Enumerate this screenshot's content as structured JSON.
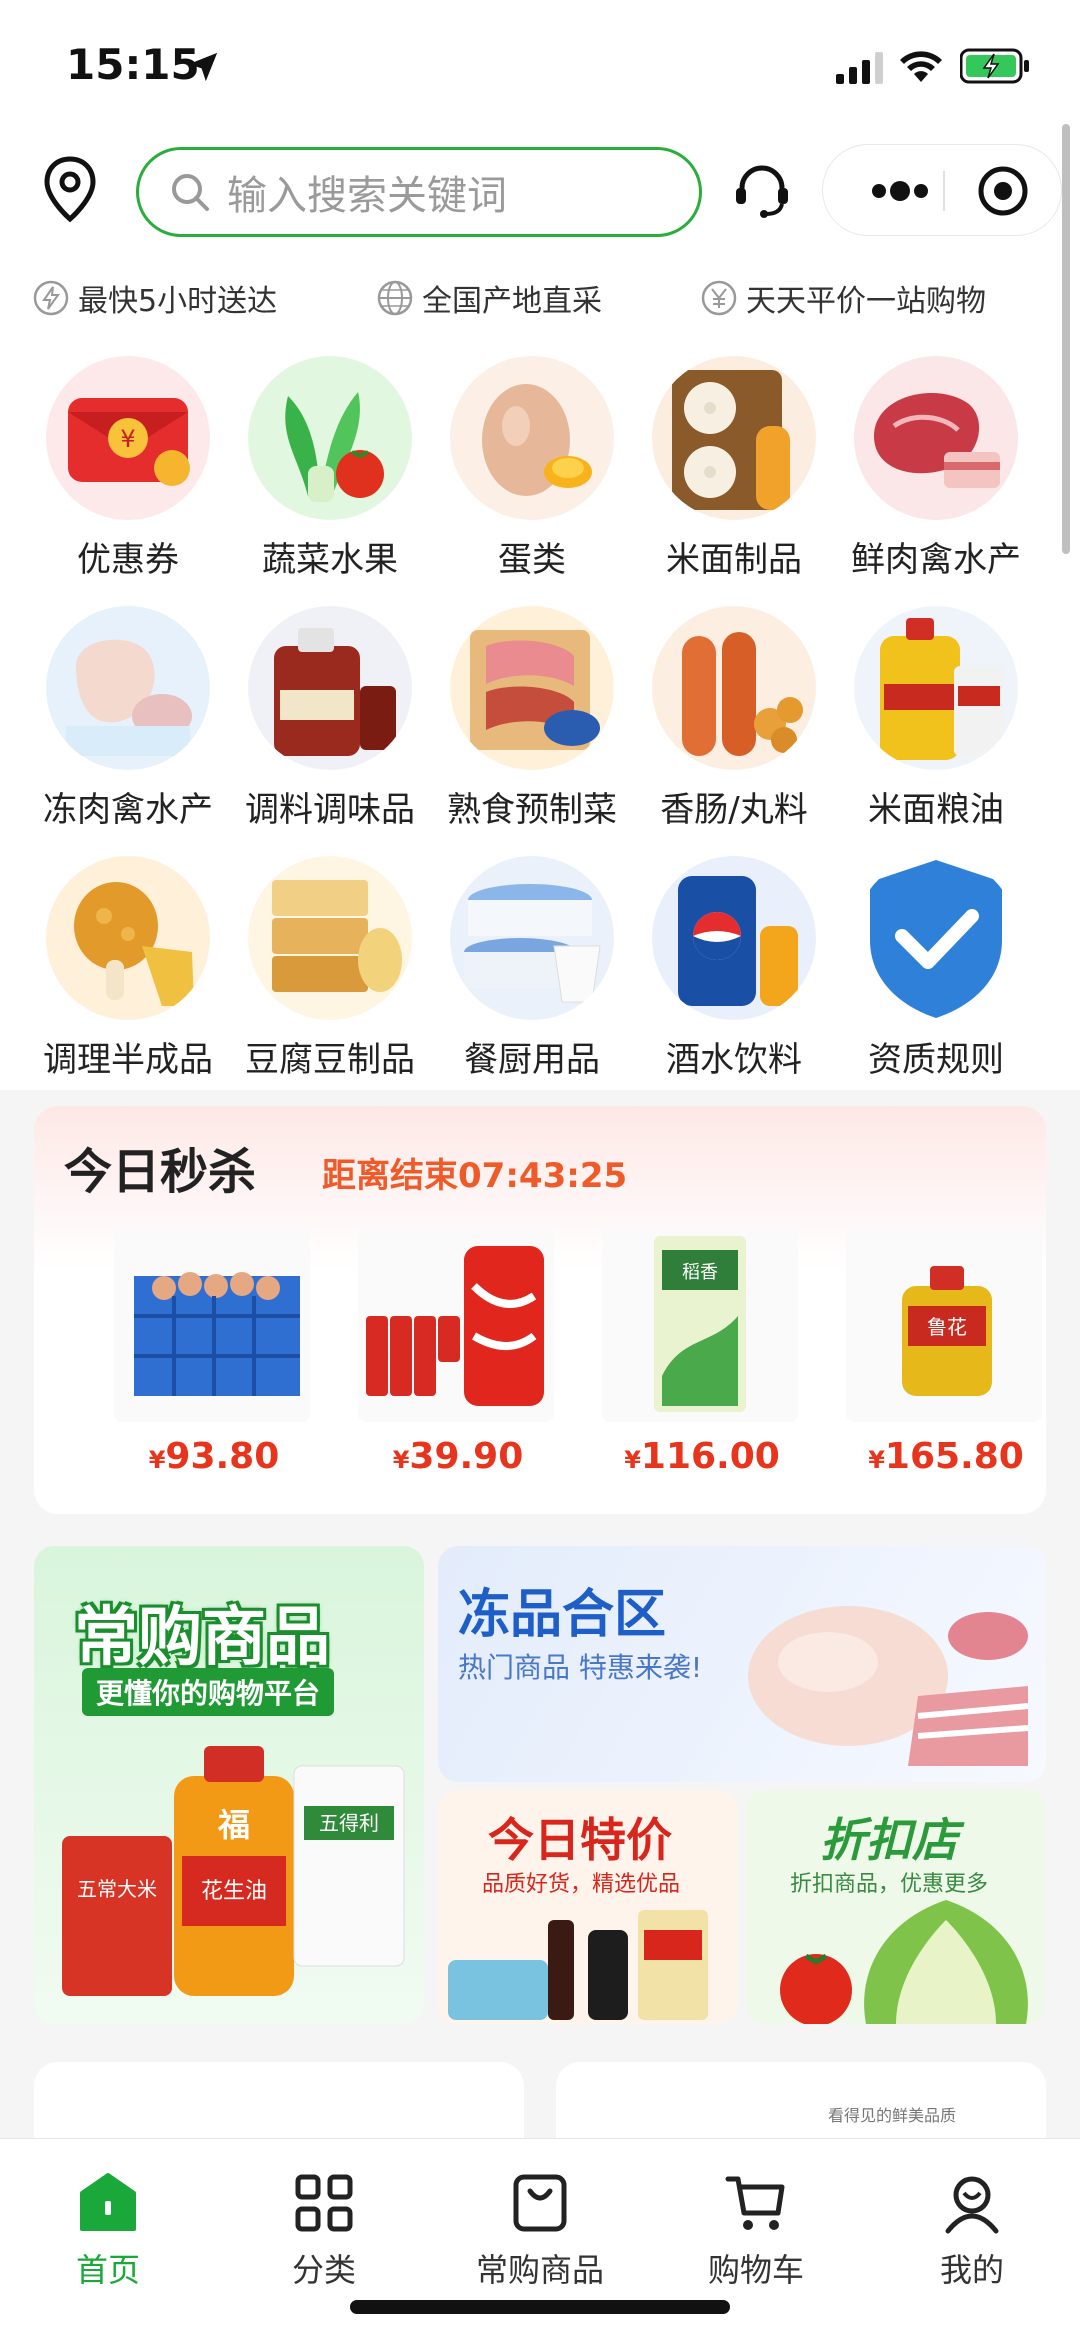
{
  "status_bar": {
    "time": "15:15"
  },
  "header": {
    "search_placeholder": "输入搜索关键词"
  },
  "features": [
    "最快5小时送达",
    "全国产地直采",
    "天天平价一站购物"
  ],
  "categories": [
    {
      "label": "优惠券",
      "icon": "coupon-icon"
    },
    {
      "label": "蔬菜水果",
      "icon": "vegetables-icon"
    },
    {
      "label": "蛋类",
      "icon": "eggs-icon"
    },
    {
      "label": "米面制品",
      "icon": "buns-icon"
    },
    {
      "label": "鲜肉禽水产",
      "icon": "fresh-meat-icon"
    },
    {
      "label": "冻肉禽水产",
      "icon": "frozen-meat-icon"
    },
    {
      "label": "调料调味品",
      "icon": "seasoning-icon"
    },
    {
      "label": "熟食预制菜",
      "icon": "deli-icon"
    },
    {
      "label": "香肠/丸料",
      "icon": "sausage-icon"
    },
    {
      "label": "米面粮油",
      "icon": "grain-oil-icon"
    },
    {
      "label": "调理半成品",
      "icon": "fried-chicken-icon"
    },
    {
      "label": "豆腐豆制品",
      "icon": "tofu-icon"
    },
    {
      "label": "餐厨用品",
      "icon": "tableware-icon"
    },
    {
      "label": "酒水饮料",
      "icon": "drinks-icon"
    },
    {
      "label": "资质规则",
      "icon": "shield-check-icon"
    }
  ],
  "flash_sale": {
    "title": "今日秒杀",
    "countdown": "距离结束07:43:25",
    "currency": "¥",
    "products": [
      {
        "price": "93.80"
      },
      {
        "price": "39.90"
      },
      {
        "price": "116.00"
      },
      {
        "price": "165.80"
      }
    ],
    "product_texts": {
      "oil": "鲁花",
      "rice": "稻香"
    }
  },
  "banners": {
    "frequent": {
      "title": "常购商品",
      "subtitle": "更懂你的购物平台",
      "products": {
        "rice": "五常大米",
        "oil": "花生油",
        "flour": "五得利",
        "oil_brand": "福"
      }
    },
    "frozen": {
      "title": "冻品合区",
      "subtitle": "热门商品 特惠来袭!"
    },
    "special": {
      "title": "今日特价",
      "subtitle": "品质好货，精选优品"
    },
    "discount": {
      "title": "折扣店",
      "subtitle": "折扣商品，优惠更多"
    }
  },
  "peek_card_text": "看得见的鲜美品质",
  "tabbar": [
    {
      "label": "首页",
      "icon": "home-icon",
      "active": true
    },
    {
      "label": "分类",
      "icon": "category-grid-icon",
      "active": false
    },
    {
      "label": "常购商品",
      "icon": "bag-icon",
      "active": false
    },
    {
      "label": "购物车",
      "icon": "cart-icon",
      "active": false
    },
    {
      "label": "我的",
      "icon": "profile-icon",
      "active": false
    }
  ],
  "colors": {
    "brand_green": "#1aa83a",
    "search_border": "#2aad3a",
    "price_red": "#e8341c",
    "countdown_orange": "#f05a28"
  }
}
